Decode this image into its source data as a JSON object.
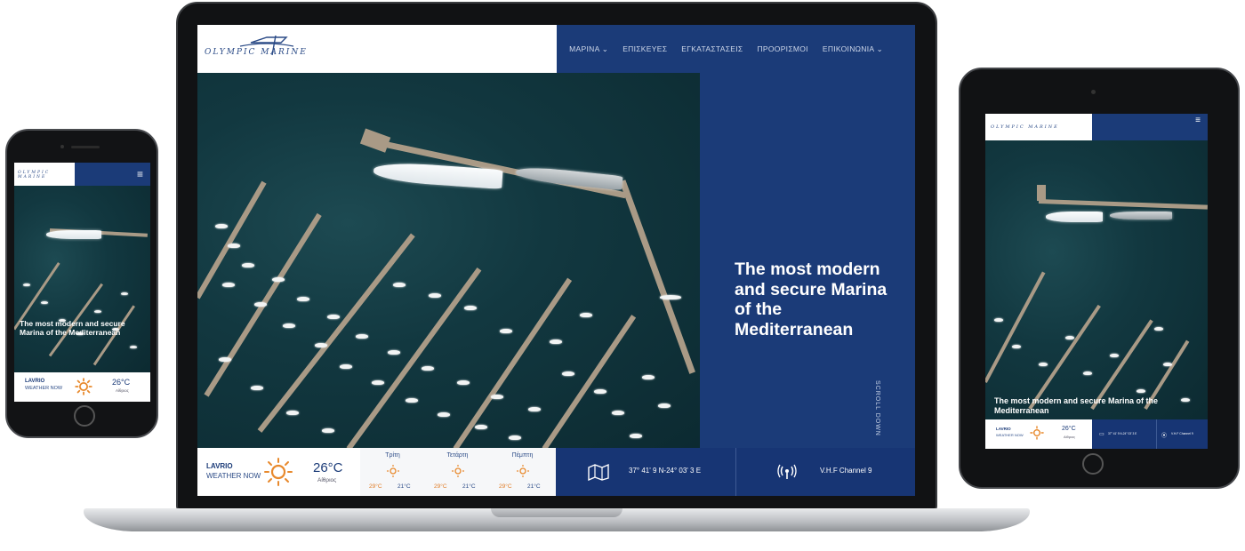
{
  "brand": {
    "logo_text": "OLYMPIC MARINE",
    "primary_color": "#1b3b78",
    "accent_color": "#e8892c"
  },
  "nav": {
    "items": [
      {
        "label": "ΜΑΡΙΝΑ",
        "has_dropdown": true
      },
      {
        "label": "ΕΠΙΣΚΕΥΕΣ",
        "has_dropdown": false
      },
      {
        "label": "ΕΓΚΑΤΑΣΤΑΣΕΙΣ",
        "has_dropdown": false
      },
      {
        "label": "ΠΡΟΟΡΙΣΜΟΙ",
        "has_dropdown": false
      },
      {
        "label": "ΕΠΙΚΟΙΝΩΝΙΑ",
        "has_dropdown": true
      }
    ]
  },
  "hero": {
    "headline": "The most modern and secure Marina of the Mediterranean",
    "scroll_label": "SCROLL DOWN"
  },
  "weather": {
    "city": "LAVRIO",
    "now_label": "WEATHER NOW",
    "temp": "26°C",
    "condition": "Αίθριος",
    "icon": "sun-icon",
    "days": [
      {
        "name": "Τρίτη",
        "high": "29°C",
        "low": "21°C"
      },
      {
        "name": "Τετάρτη",
        "high": "29°C",
        "low": "21°C"
      },
      {
        "name": "Πέμπτη",
        "high": "29°C",
        "low": "21°C"
      }
    ]
  },
  "info": {
    "coordinates": "37° 41' 9 N-24° 03' 3 E",
    "coord_icon": "map-icon",
    "vhf": "V.H.F Channel 9",
    "vhf_icon": "radio-signal-icon"
  },
  "mobile": {
    "headline": "The most modern and secure Marina of the Mediterranean",
    "city": "LAVRIO",
    "now_label": "WEATHER NOW",
    "temp": "26°C",
    "condition": "Αίθριος"
  },
  "tablet": {
    "headline": "The most modern and secure Marina of the Mediterranean",
    "city": "LAVRIO",
    "now_label": "WEATHER NOW",
    "temp": "26°C",
    "condition": "Αίθριος",
    "coordinates": "37° 41' 9 N-24° 03' 3 E",
    "vhf": "V.H.F Channel 9"
  }
}
